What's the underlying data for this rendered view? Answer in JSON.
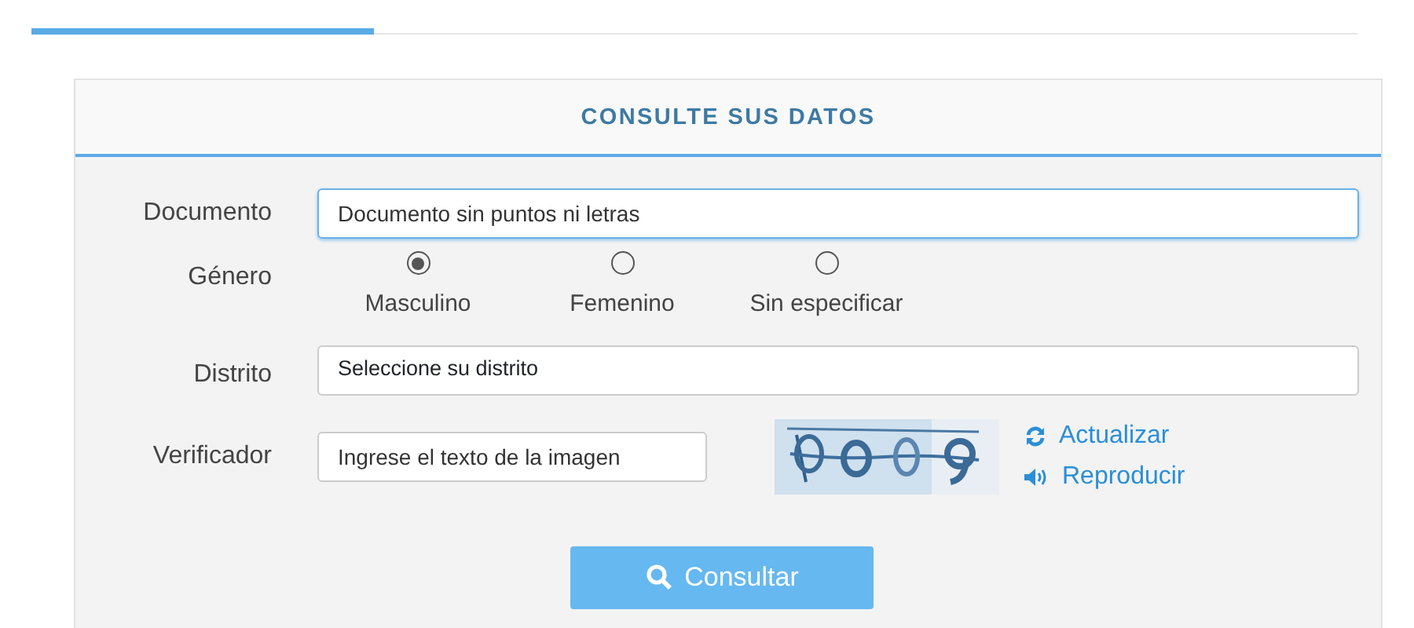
{
  "tab_strip": {
    "active_tab_selected": true
  },
  "form": {
    "title": "CONSULTE SUS DATOS",
    "documento": {
      "label": "Documento",
      "placeholder": "Documento sin puntos ni letras",
      "focused": true
    },
    "genero": {
      "label": "Género",
      "options": [
        {
          "label": "Masculino",
          "selected": true
        },
        {
          "label": "Femenino",
          "selected": false
        },
        {
          "label": "Sin especificar",
          "selected": false
        }
      ]
    },
    "distrito": {
      "label": "Distrito",
      "value": "Seleccione su distrito"
    },
    "verificador": {
      "label": "Verificador",
      "placeholder": "Ingrese el texto de la imagen",
      "links": [
        {
          "kind": "refresh",
          "label": "Actualizar"
        },
        {
          "kind": "audio",
          "label": "Reproducir"
        }
      ]
    },
    "submit": {
      "label": "Consultar"
    }
  }
}
